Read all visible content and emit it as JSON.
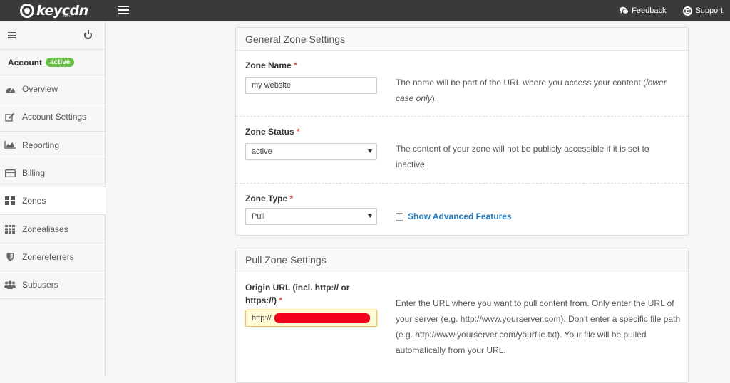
{
  "topbar": {
    "logo_text": "keycdn",
    "logo_sub": ".com",
    "feedback_label": "Feedback",
    "support_label": "Support"
  },
  "sidebar": {
    "account_label": "Account",
    "account_status": "active",
    "items": [
      {
        "label": "Overview",
        "icon": "dashboard-icon"
      },
      {
        "label": "Account Settings",
        "icon": "edit-icon"
      },
      {
        "label": "Reporting",
        "icon": "area-chart-icon"
      },
      {
        "label": "Billing",
        "icon": "credit-card-icon"
      },
      {
        "label": "Zones",
        "icon": "grid-icon",
        "active": true
      },
      {
        "label": "Zonealiases",
        "icon": "grid-dots-icon"
      },
      {
        "label": "Zonereferrers",
        "icon": "shield-icon"
      },
      {
        "label": "Subusers",
        "icon": "users-icon"
      }
    ]
  },
  "general": {
    "title": "General Zone Settings",
    "zone_name": {
      "label": "Zone Name",
      "required": "*",
      "value": "my website",
      "help_a": "The name will be part of the URL where you access your content (",
      "help_em": "lower case only",
      "help_b": ")."
    },
    "zone_status": {
      "label": "Zone Status",
      "required": "*",
      "value": "active",
      "help": "The content of your zone will not be publicly accessible if it is set to inactive."
    },
    "zone_type": {
      "label": "Zone Type",
      "required": "*",
      "value": "Pull",
      "advanced_label": "Show Advanced Features"
    }
  },
  "pull": {
    "title": "Pull Zone Settings",
    "origin": {
      "label_line1": "Origin URL (incl. http:// or",
      "label_line2": "https://)",
      "required": "*",
      "value_prefix": "http://",
      "help_a": "Enter the URL where you want to pull content from. Only enter the URL of your server (e.g. http://www.yourserver.com). Don't enter a specific file path (e.g. ",
      "help_strike": "http://www.yourserver.com/yourfile.txt",
      "help_b": "). Your file will be pulled automatically from your URL."
    }
  }
}
